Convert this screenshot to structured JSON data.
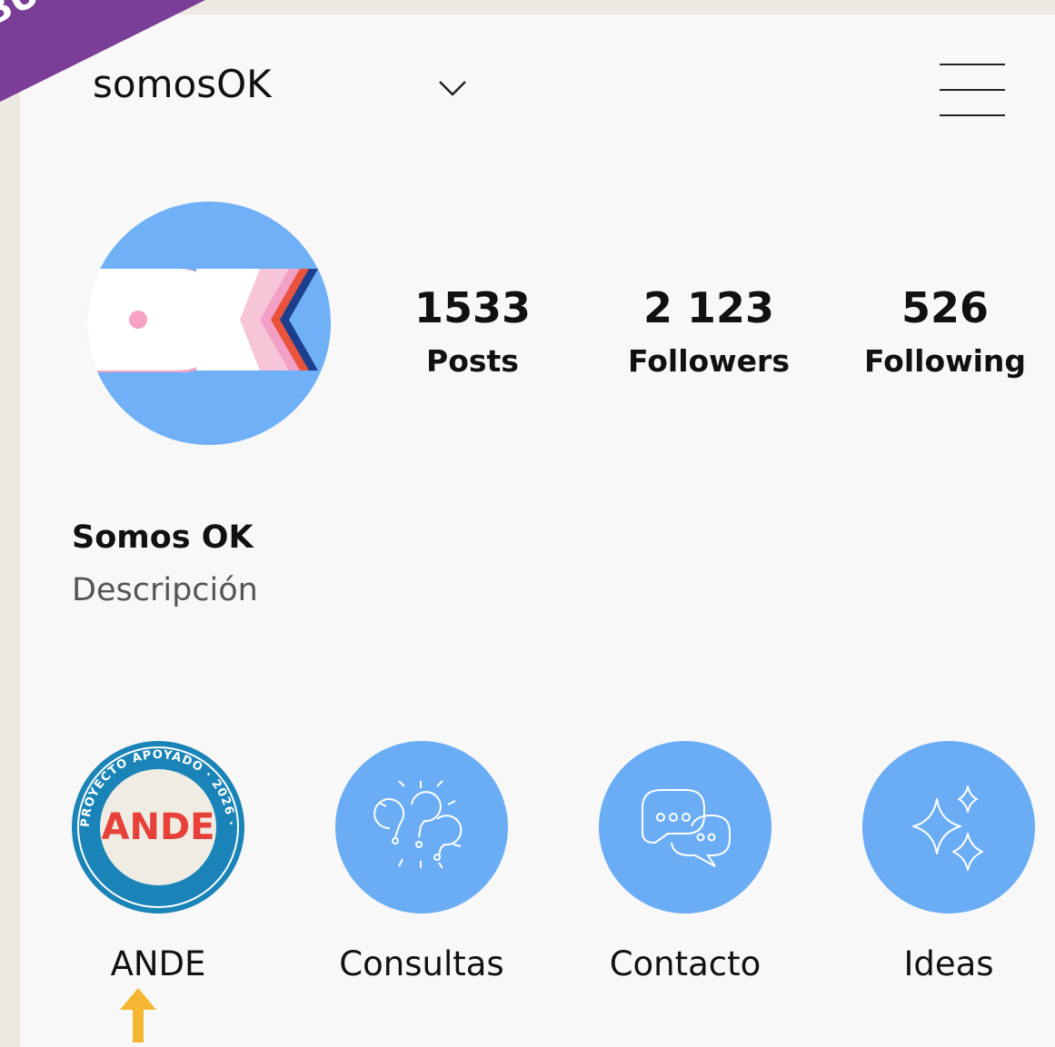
{
  "ribbon": {
    "text": "BUSCADO"
  },
  "header": {
    "username": "somosOK"
  },
  "profile": {
    "avatar_logo_text": "OK",
    "display_name": "Somos OK",
    "description": "Descripción"
  },
  "stats": [
    {
      "value": "1533",
      "label": "Posts"
    },
    {
      "value": "2 123",
      "label": "Followers"
    },
    {
      "value": "526",
      "label": "Following"
    }
  ],
  "highlights": [
    {
      "label": "ANDE",
      "badge_text": "PROYECTO APOYADO · 2026 ·",
      "badge_logo": "ANDE"
    },
    {
      "label": "Consultas",
      "icon": "question-bubbles-icon"
    },
    {
      "label": "Contacto",
      "icon": "chat-bubbles-icon"
    },
    {
      "label": "Ideas",
      "icon": "sparkles-icon"
    }
  ],
  "colors": {
    "accent_blue": "#6aadf5",
    "ribbon_purple": "#7a3e98",
    "arrow_yellow": "#f5b731"
  }
}
